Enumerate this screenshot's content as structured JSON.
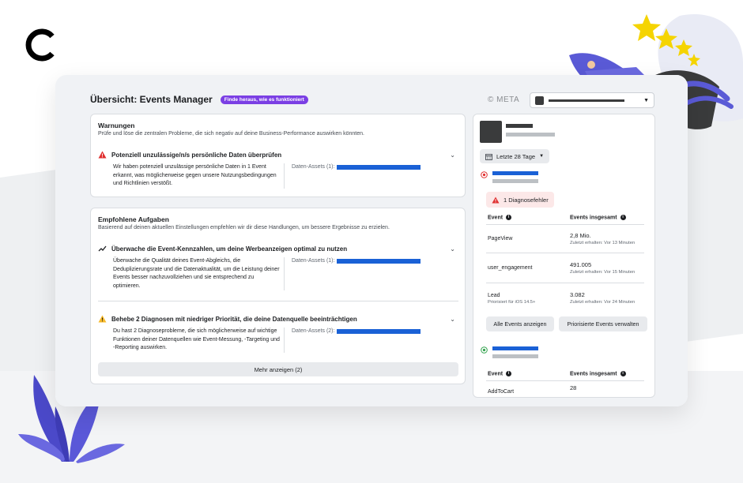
{
  "header": {
    "title": "Übersicht: Events Manager",
    "help_pill": "Finde heraus, wie es funktioniert",
    "meta_label": "© META"
  },
  "warnings": {
    "title": "Warnungen",
    "subtitle": "Prüfe und löse die zentralen Probleme, die sich negativ auf deine Business-Performance auswirken könnten.",
    "item": {
      "title": "Potenziell unzulässige/n/s persönliche Daten überprüfen",
      "description": "Wir haben potenziell unzulässige persönliche Daten in 1 Event erkannt, was möglicherweise gegen unsere Nutzungsbedingungen und Richtlinien verstößt.",
      "asset_label": "Daten-Assets (1):"
    }
  },
  "tasks": {
    "title": "Empfohlene Aufgaben",
    "subtitle": "Basierend auf deinen aktuellen Einstellungen empfehlen wir dir diese Handlungen, um bessere Ergebnisse zu erzielen.",
    "items": [
      {
        "title": "Überwache die Event-Kennzahlen, um deine Werbeanzeigen optimal zu nutzen",
        "description": "Überwache die Qualität deines Event-Abgleichs, die Deduplizierungsrate und die Datenaktualität, um die Leistung deiner Events besser nachzuvollziehen und sie entsprechend zu optimieren.",
        "asset_label": "Daten-Assets (1):"
      },
      {
        "title": "Behebe 2 Diagnosen mit niedriger Priorität, die deine Datenquelle beeinträchtigen",
        "description": "Du hast 2 Diagnoseprobleme, die sich möglicherweise auf wichtige Funktionen deiner Datenquellen wie Event-Messung, -Targeting und -Reporting auswirken.",
        "asset_label": "Daten-Assets (2):"
      }
    ],
    "more_button": "Mehr anzeigen (2)"
  },
  "right": {
    "date_range": "Letzte 28 Tage",
    "diagnostic_badge": "1 Diagnosefehler",
    "table1": {
      "col_event": "Event",
      "col_total": "Events insgesamt",
      "rows": [
        {
          "event": "PageView",
          "event_sub": "",
          "value": "2,8 Mio.",
          "sub": "Zuletzt erhalten: Vor 13 Minuten"
        },
        {
          "event": "user_engagement",
          "event_sub": "",
          "value": "491.005",
          "sub": "Zuletzt erhalten: Vor 15 Minuten"
        },
        {
          "event": "Lead",
          "event_sub": "Priorisiert für iOS 14.5+",
          "value": "3.082",
          "sub": "Zuletzt erhalten: Vor 24 Minuten"
        }
      ]
    },
    "buttons": {
      "all_events": "Alle Events anzeigen",
      "manage_prioritized": "Priorisierte Events verwalten"
    },
    "table2": {
      "col_event": "Event",
      "col_total": "Events insgesamt",
      "rows": [
        {
          "event": "AddToCart",
          "value": "28"
        }
      ]
    }
  },
  "colors": {
    "accent_blue": "#1a61d6",
    "pill_purple": "#7b3fe4",
    "error_red": "#e02f2f",
    "warning_yellow": "#f7b928",
    "active_green": "#31a24c"
  }
}
